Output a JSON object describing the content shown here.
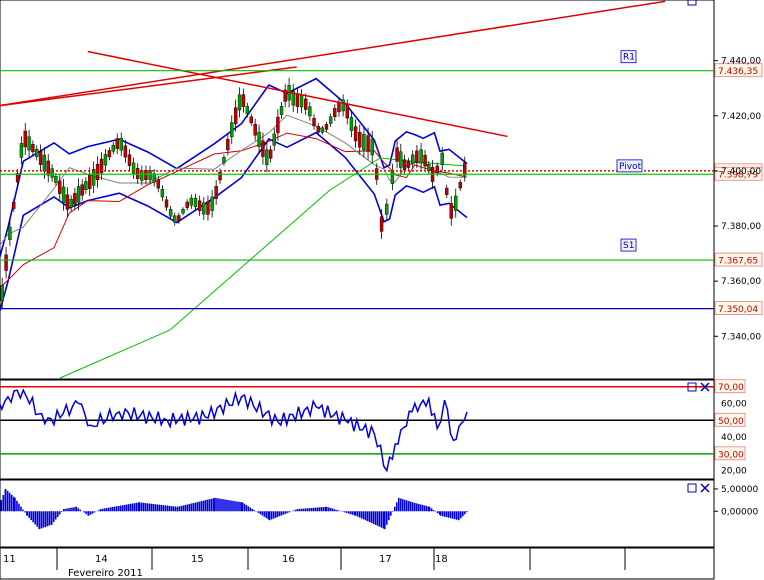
{
  "chart_data": [
    {
      "type": "candlestick",
      "panel": "price",
      "y_ticks": [
        {
          "value": 7440,
          "label": "7.440,00"
        },
        {
          "value": 7420,
          "label": "7.420,00"
        },
        {
          "value": 7400,
          "label": "7.400,00"
        },
        {
          "value": 7380,
          "label": "7.380,00"
        },
        {
          "value": 7360,
          "label": "7.360,00"
        },
        {
          "value": 7340,
          "label": "7.340,00"
        }
      ],
      "ylim": [
        7324.5,
        7462
      ],
      "levels": [
        {
          "name": "R1",
          "value": 7436.35,
          "label": "7.436,35",
          "color": "#00c000",
          "text_color": "#c00000"
        },
        {
          "name": "Pivot",
          "value": 7400.01,
          "label": "7.400,01",
          "color": "#e00000",
          "text_color": "#c00000",
          "dotted": true
        },
        {
          "name": "",
          "value": 7398.79,
          "label": "7.398,79",
          "color": "#00d000",
          "text_color": "#c00000"
        },
        {
          "name": "S1",
          "value": 7367.65,
          "label": "7.367,65",
          "color": "#00c000",
          "text_color": "#c00000"
        },
        {
          "name": "",
          "value": 7350.04,
          "label": "7.350,04",
          "color": "#0000c0",
          "text_color": "#c00000"
        }
      ],
      "series": [
        {
          "kind": "close",
          "color": "#000000",
          "x": [
            10.5,
            11.0,
            11.5,
            12.5,
            13.0,
            13.6,
            14.2,
            14.5,
            14.8,
            15.2,
            15.5,
            15.8,
            16.0,
            16.3,
            16.6,
            16.9,
            17.0,
            17.1,
            17.2,
            17.4,
            17.55,
            17.7,
            17.9,
            18.0,
            18.1,
            18.3
          ],
          "values": [
            7328,
            7370,
            7410,
            7400,
            7390,
            7398,
            7408,
            7398,
            7384,
            7390,
            7425,
            7406,
            7432,
            7416,
            7422,
            7405,
            7376,
            7392,
            7408,
            7402,
            7402,
            7405,
            7398,
            7408,
            7385,
            7400
          ]
        }
      ],
      "annotations": [
        {
          "text": "R1"
        },
        {
          "text": "Pivot"
        },
        {
          "text": "S1"
        }
      ]
    },
    {
      "type": "line",
      "panel": "oscillator",
      "y_ticks": [
        {
          "value": 60,
          "label": "60,00"
        },
        {
          "value": 40,
          "label": "40,00"
        },
        {
          "value": 20,
          "label": "20,00"
        }
      ],
      "levels": [
        {
          "value": 70,
          "label": "70,00",
          "color": "#e00000"
        },
        {
          "value": 50,
          "label": "50,00",
          "color": "#000000"
        },
        {
          "value": 30,
          "label": "30,00",
          "color": "#00a000"
        }
      ],
      "ylim": [
        15,
        74
      ],
      "series": [
        {
          "color": "#0000e0",
          "x": [
            10.5,
            11.0,
            11.5,
            12.2,
            12.8,
            13.3,
            13.7,
            14.2,
            14.7,
            15.1,
            15.5,
            15.9,
            16.3,
            16.6,
            16.9,
            17.05,
            17.2,
            17.5,
            17.8,
            17.95,
            18.05,
            18.15,
            18.3
          ],
          "values": [
            53,
            64,
            68,
            48,
            54,
            60,
            47,
            55,
            50,
            52,
            64,
            49,
            58,
            50,
            42,
            20,
            36,
            55,
            63,
            45,
            62,
            38,
            55
          ]
        }
      ]
    },
    {
      "type": "bar",
      "panel": "histogram",
      "y_ticks": [
        {
          "value": 5,
          "label": "5,00000"
        },
        {
          "value": 0,
          "label": "0,00000"
        }
      ],
      "ylim": [
        -8,
        7
      ],
      "series": [
        {
          "color": "#0000e0",
          "x": [
            10.5,
            10.9,
            11.2,
            11.6,
            12.0,
            12.4,
            12.8,
            13.2,
            13.6,
            14.0,
            14.4,
            14.8,
            15.2,
            15.5,
            15.8,
            16.1,
            16.4,
            16.7,
            17.0,
            17.25,
            17.5,
            17.8,
            18.0,
            18.2,
            18.3
          ],
          "values": [
            -2,
            5,
            3,
            -1,
            -4,
            -3,
            0.5,
            1,
            -1,
            0.5,
            2,
            1,
            3,
            2,
            -2,
            0.5,
            1,
            -1,
            -4,
            3,
            2,
            1,
            -1,
            -2,
            0
          ]
        }
      ]
    }
  ],
  "x_axis": {
    "ticks": [
      {
        "value": 11,
        "label": "11"
      },
      {
        "value": 14,
        "label": "14"
      },
      {
        "value": 15,
        "label": "15"
      },
      {
        "value": 16,
        "label": "16"
      },
      {
        "value": 17,
        "label": "17"
      },
      {
        "value": 18,
        "label": "18"
      }
    ],
    "month_label": "Fevereiro 2011"
  },
  "drawn_lines": [
    {
      "name": "upper-trend",
      "color": "#e00000",
      "points": [
        {
          "x": 10.62,
          "y": 7423.5
        },
        {
          "x": 20.5,
          "y": 7461.5
        }
      ]
    },
    {
      "name": "resistance-trend",
      "color": "#e00000",
      "points": [
        {
          "x": 13.6,
          "y": 7443.3
        },
        {
          "x": 18.75,
          "y": 7412.5
        }
      ]
    },
    {
      "name": "low-trend",
      "color": "#e00000",
      "points": [
        {
          "x": 10.62,
          "y": 7423.5
        },
        {
          "x": 16.1,
          "y": 7437.7
        }
      ]
    }
  ],
  "colors": {
    "grid": "#c8c8c8",
    "up_candle": "#00a000",
    "down_candle": "#c00000",
    "bollinger": "#0000e0",
    "ma_long": "#00c000",
    "ma_mid": "#d00000",
    "ma_short": "#808080"
  },
  "panel_buttons": [
    {
      "name": "square-icon"
    },
    {
      "name": "close-icon"
    }
  ]
}
